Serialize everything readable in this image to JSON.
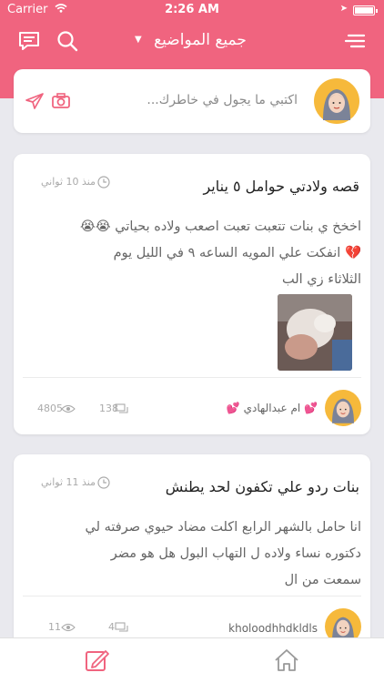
{
  "status_bar": {
    "carrier": "Carrier",
    "time": "2:26 AM"
  },
  "nav": {
    "title": "جميع المواضيع",
    "caret": "▼"
  },
  "composer": {
    "placeholder": "اكتبي ما يجول في خاطرك..."
  },
  "posts": [
    {
      "title": "قصه ولادتي  حوامل ٥ يناير",
      "time": "منذ 10 ثواني",
      "body_line1": "اخخخ ي بنات تتعبت تعبت اصعب ولاده بحياتي 😭😭",
      "body_line2": "💔  انفكت علي المويه الساعه ٩ في الليل يوم",
      "body_line3": "الثلاثاء زي الب",
      "author": "💕 ام عبدالهادي 💕",
      "views": "4805",
      "comments": "138"
    },
    {
      "title": "بنات ردو علي تكفون لحد يطنش",
      "time": "منذ 11 ثواني",
      "body_line1": "انا حامل بالشهر الرابع اكلت مضاد حيوي صرفته لي",
      "body_line2": "دكتوره نساء ولاده ل التهاب البول هل هو مضر",
      "body_line3": "سمعت من ال",
      "author": "kholoodhhdkldls",
      "views": "11",
      "comments": "4"
    }
  ],
  "colors": {
    "brand": "#f0647f",
    "background": "#e9e9ee"
  },
  "icons": [
    "wifi-icon",
    "battery-icon",
    "chat-icon",
    "search-icon",
    "menu-icon",
    "camera-icon",
    "send-icon",
    "clock-icon",
    "eye-icon",
    "comments-icon",
    "compose-icon",
    "home-icon"
  ]
}
